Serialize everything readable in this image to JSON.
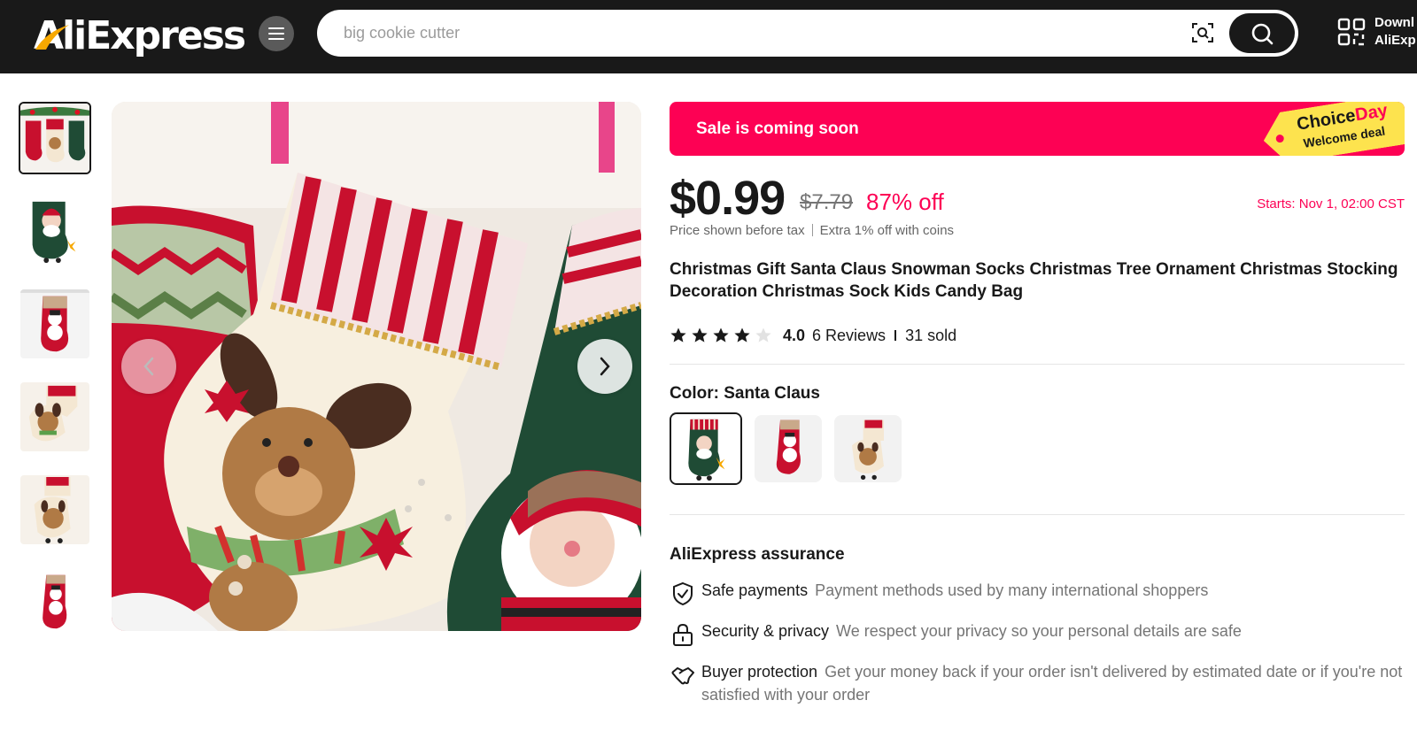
{
  "header": {
    "logo_text": "AliExpress",
    "search": {
      "placeholder": "big cookie cutter"
    },
    "app_download": {
      "line1": "Downl",
      "line2": "AliExp"
    }
  },
  "gallery": {
    "thumbnails": [
      {
        "label": "three stockings",
        "active": true
      },
      {
        "label": "santa stocking black"
      },
      {
        "label": "snowman stocking"
      },
      {
        "label": "reindeer stocking"
      },
      {
        "label": "reindeer stocking 2"
      },
      {
        "label": "snowman stocking 2"
      }
    ]
  },
  "sale_banner": {
    "text": "Sale is coming soon",
    "tag_word1": "Choice",
    "tag_word2": "Day",
    "tag_line2": "Welcome deal"
  },
  "price": {
    "current": "$0.99",
    "original": "$7.79",
    "discount": "87% off",
    "starts": "Starts:  Nov 1, 02:00 CST",
    "tax_note": "Price shown before tax",
    "coins_note": "Extra 1% off with coins"
  },
  "product": {
    "title": "Christmas Gift Santa Claus Snowman Socks Christmas Tree Ornament Christmas Stocking Decoration Christmas Sock Kids Candy Bag",
    "rating": "4.0",
    "rating_value": 4,
    "rating_max": 5,
    "reviews": "6 Reviews",
    "sold": "31 sold"
  },
  "color": {
    "label": "Color: Santa Claus",
    "options": [
      "Santa Claus",
      "Snowman",
      "Reindeer"
    ],
    "selected_index": 0
  },
  "assurance": {
    "title": "AliExpress assurance",
    "items": [
      {
        "icon": "shield-check-icon",
        "title": "Safe payments",
        "desc": "Payment methods used by many international shoppers"
      },
      {
        "icon": "lock-icon",
        "title": "Security & privacy",
        "desc": "We respect your privacy so your personal details are safe"
      },
      {
        "icon": "handshake-icon",
        "title": "Buyer protection",
        "desc": "Get your money back if your order isn't delivered by estimated date or if you're not satisfied with your order"
      }
    ]
  },
  "colors": {
    "header_bg": "#191919",
    "accent_red": "#fd0154",
    "choice_yellow": "#fde34e"
  }
}
